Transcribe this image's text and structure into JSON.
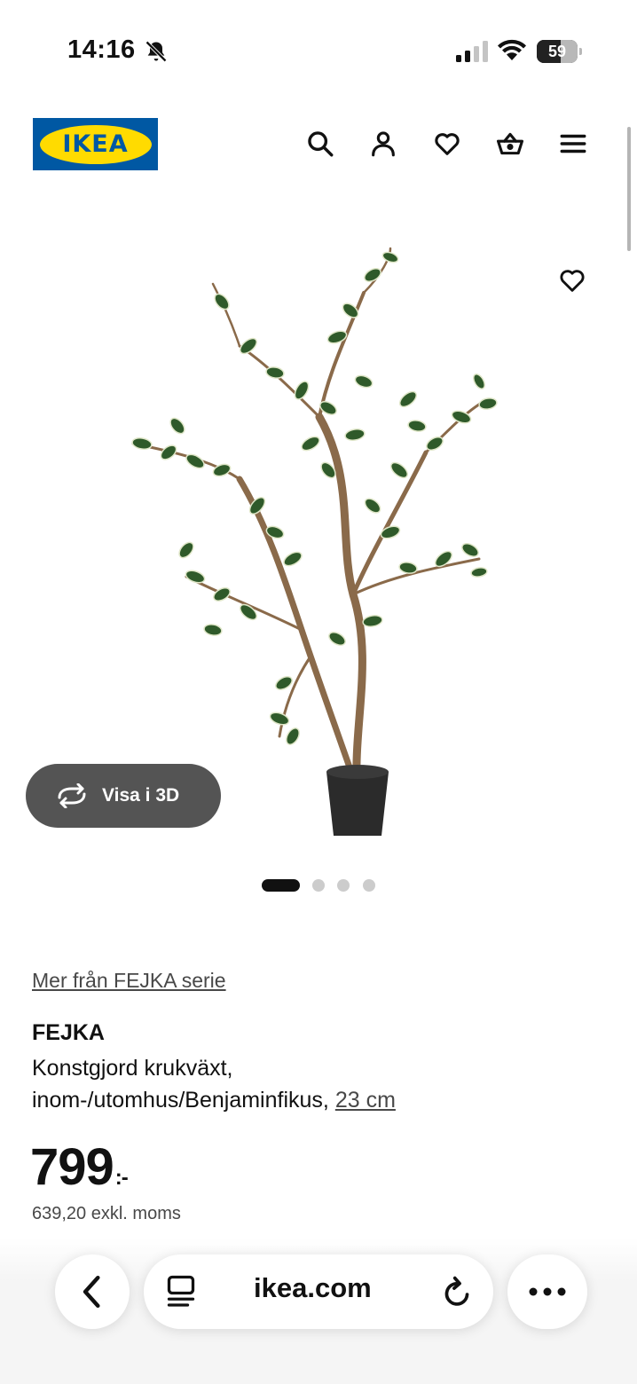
{
  "status_bar": {
    "time": "14:16",
    "battery_level": "59",
    "battery_fraction": 0.59,
    "icons": [
      "bell-slash-icon",
      "cellular-signal-icon",
      "wifi-icon",
      "battery-icon"
    ]
  },
  "header": {
    "logo_text": "IKEA",
    "icons": [
      "search-icon",
      "account-icon",
      "heart-icon",
      "basket-icon",
      "menu-icon"
    ]
  },
  "media": {
    "view_3d_label": "Visa i 3D",
    "image_count": 4,
    "active_image_index": 0
  },
  "product": {
    "series_link": "Mer från FEJKA serie",
    "name": "FEJKA",
    "description": "Konstgjord krukväxt, inom-/utomhus/Benjaminfikus, ",
    "size": "23 cm",
    "price_main": "799",
    "price_suffix": ":-",
    "price_ex_vat": "639,20 exkl. moms"
  },
  "browser": {
    "url": "ikea.com",
    "icons": [
      "back-arrow-icon",
      "tabs-icon",
      "reload-icon",
      "more-icon"
    ]
  },
  "colors": {
    "ikea_blue": "#0058a3",
    "ikea_yellow": "#ffdb00",
    "dark_button": "#545454"
  }
}
